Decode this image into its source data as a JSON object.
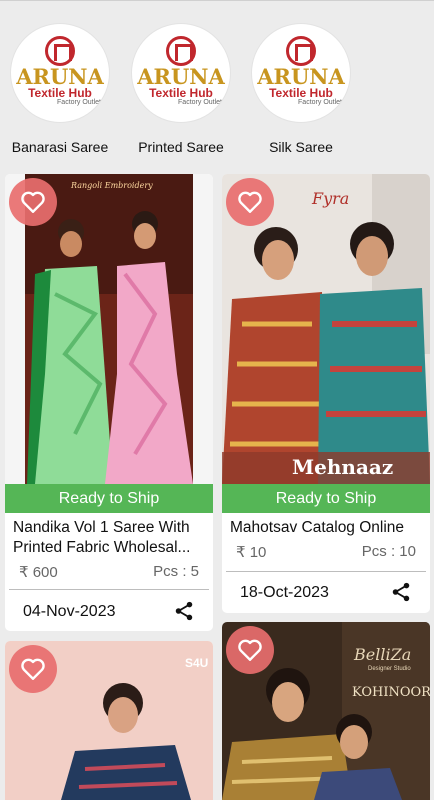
{
  "categories": [
    {
      "label": "Banarasi Saree",
      "logo_name": "ARUNA",
      "logo_sub": "Textile Hub",
      "logo_sub2": "Factory Outlet"
    },
    {
      "label": "Printed Saree",
      "logo_name": "ARUNA",
      "logo_sub": "Textile Hub",
      "logo_sub2": "Factory Outlet"
    },
    {
      "label": "Silk Saree",
      "logo_name": "ARUNA",
      "logo_sub": "Textile Hub",
      "logo_sub2": "Factory Outlet"
    }
  ],
  "products": [
    {
      "ribbon": "Ready to Ship",
      "title_line1": "Nandika Vol 1 Saree With",
      "title_line2": "Printed  Fabric Wholesal...",
      "price": "₹ 600",
      "pcs": "Pcs : 5",
      "date": "04-Nov-2023",
      "photo_caption": "Rangoli Embroidery"
    },
    {
      "ribbon": "Ready to Ship",
      "title_line1": "Mahotsav Catalog Online",
      "price": "₹ 10",
      "pcs": "Pcs : 10",
      "date": "18-Oct-2023",
      "photo_brand": "Fyra",
      "photo_caption": "Mehnaaz"
    },
    {
      "photo_brand": "S4U"
    },
    {
      "photo_brand": "BelliZa",
      "photo_caption": "KOHINOOR",
      "photo_sub": "Designer Studio"
    }
  ],
  "icons": {
    "heart": "heart-outline-icon",
    "share": "share-icon"
  },
  "colors": {
    "ribbon": "#55b656",
    "heart_bg": "#e86e6e",
    "logo_red": "#c0272d",
    "logo_gold": "#c8951f"
  }
}
